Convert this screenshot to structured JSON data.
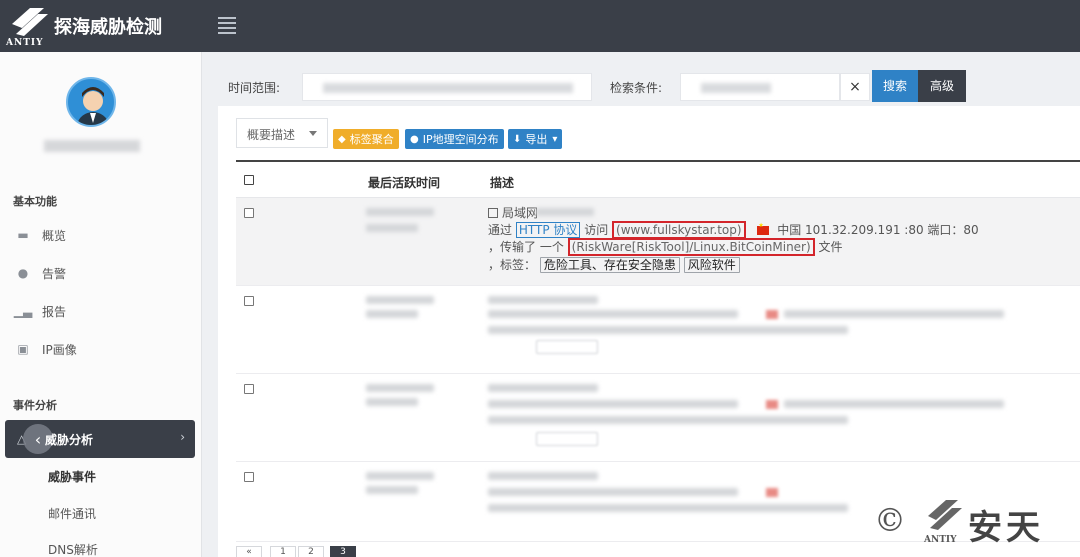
{
  "app": {
    "title": "探海威胁检测",
    "logo_text": "ANTIY"
  },
  "sidebar": {
    "sections": [
      {
        "title": "基本功能"
      },
      {
        "title": "事件分析"
      }
    ],
    "items": [
      {
        "label": "概览",
        "icon": "monitor-icon"
      },
      {
        "label": "告警",
        "icon": "drop-icon"
      },
      {
        "label": "报告",
        "icon": "chart-icon"
      },
      {
        "label": "IP画像",
        "icon": "image-icon"
      }
    ],
    "active": {
      "label": "威胁分析",
      "icon": "alert-icon"
    },
    "subitems": [
      {
        "label": "威胁事件",
        "active": true
      },
      {
        "label": "邮件通讯",
        "active": false
      },
      {
        "label": "DNS解析",
        "active": false
      }
    ]
  },
  "filters": {
    "time_label": "时间范围:",
    "query_label": "检索条件:",
    "clear": "×",
    "search_btn": "搜索",
    "advanced_btn": "高级"
  },
  "toolbar": {
    "summary_select": "概要描述",
    "tag_aggregate": "标签聚合",
    "ip_distribution": "IP地理空间分布",
    "export": "导出"
  },
  "table": {
    "headers": {
      "last_active": "最后活跃时间",
      "description": "描述"
    },
    "first_row": {
      "network": "局域网",
      "via": "通过",
      "protocol": "HTTP 协议",
      "visit": "访问",
      "domain": "(www.fullskystar.top)",
      "location": "中国 101.32.209.191 :80 端口：80",
      "transmit": "，传输了 一个",
      "malware": "(RiskWare[RiskTool]/Linux.BitCoinMiner)",
      "file": "文件",
      "tags_label": "，标签：",
      "tags": [
        "危险工具、存在安全隐患",
        "风险软件"
      ]
    }
  },
  "pagination": {
    "pages": [
      "«",
      "1",
      "2",
      "3"
    ]
  },
  "watermark": {
    "copyright": "©",
    "brand": "安天",
    "brand_sub": "ANTIY"
  },
  "colors": {
    "topbar": "#3a3f48",
    "primary": "#2f82c6",
    "warning": "#f0ad2a",
    "highlight_border": "#d3252b"
  }
}
